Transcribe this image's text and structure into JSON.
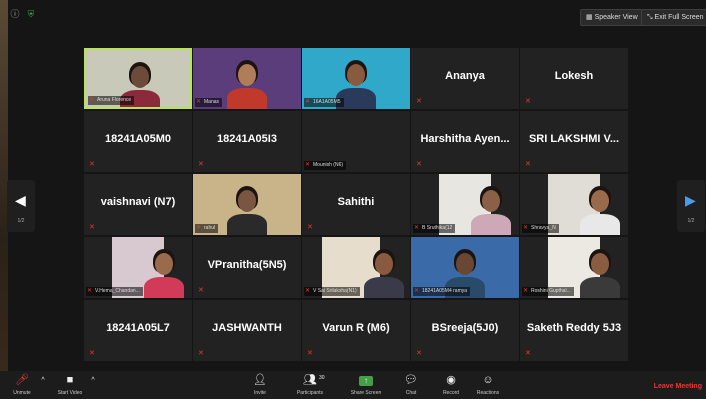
{
  "window": {
    "speaker_view_label": "Speaker View",
    "exit_fullscreen_label": "Exit Full Screen"
  },
  "navigation": {
    "prev_page": "1/2",
    "next_page": "1/2"
  },
  "participants": [
    {
      "display": "",
      "caption": "Aruna Florence",
      "video": true
    },
    {
      "display": "",
      "caption": "Manas",
      "video": true
    },
    {
      "display": "",
      "caption": "16A1A05M5",
      "video": true
    },
    {
      "display": "Ananya",
      "caption": "",
      "video": false
    },
    {
      "display": "Lokesh",
      "caption": "",
      "video": false
    },
    {
      "display": "18241A05M0",
      "caption": "",
      "video": false
    },
    {
      "display": "18241A05I3",
      "caption": "",
      "video": false
    },
    {
      "display": "",
      "caption": "Mounish (N6)",
      "video": false
    },
    {
      "display": "Harshitha  Ayen...",
      "caption": "",
      "video": false
    },
    {
      "display": "SRI LAKSHMI V...",
      "caption": "",
      "video": false
    },
    {
      "display": "vaishnavi (N7)",
      "caption": "",
      "video": false
    },
    {
      "display": "",
      "caption": "rahul",
      "video": true
    },
    {
      "display": "Sahithi",
      "caption": "",
      "video": false
    },
    {
      "display": "",
      "caption": "B Sruthika(12",
      "video": true
    },
    {
      "display": "",
      "caption": "Shravya_N",
      "video": true
    },
    {
      "display": "",
      "caption": "V.Hema_Chandan...",
      "video": true
    },
    {
      "display": "VPranitha(5N5)",
      "caption": "",
      "video": false
    },
    {
      "display": "",
      "caption": "V Sai Srilaksha(N1)",
      "video": true
    },
    {
      "display": "",
      "caption": "18241A05M4 ramya",
      "video": true
    },
    {
      "display": "",
      "caption": "Roshini Gupthal...",
      "video": true
    },
    {
      "display": "18241A05L7",
      "caption": "",
      "video": false
    },
    {
      "display": "JASHWANTH",
      "caption": "",
      "video": false
    },
    {
      "display": "Varun R (M6)",
      "caption": "",
      "video": false
    },
    {
      "display": "BSreeja(5J0)",
      "caption": "",
      "video": false
    },
    {
      "display": "Saketh Reddy 5J3",
      "caption": "",
      "video": false
    }
  ],
  "toolbar": {
    "unmute": "Unmute",
    "start_video": "Start Video",
    "invite": "Invite",
    "participants": "Participants",
    "participants_count": "30",
    "share_screen": "Share Screen",
    "chat": "Chat",
    "record": "Record",
    "reactions": "Reactions",
    "leave": "Leave Meeting"
  },
  "colors": {
    "active_speaker": "#b9e35a",
    "muted": "#e53935",
    "share_screen": "#43a047",
    "leave": "#e53935"
  },
  "icons": [
    "info-icon",
    "shield-icon",
    "microphone-muted-icon",
    "video-camera-icon",
    "invite-icon",
    "participants-icon",
    "share-screen-icon",
    "chat-icon",
    "record-icon",
    "reactions-icon"
  ]
}
